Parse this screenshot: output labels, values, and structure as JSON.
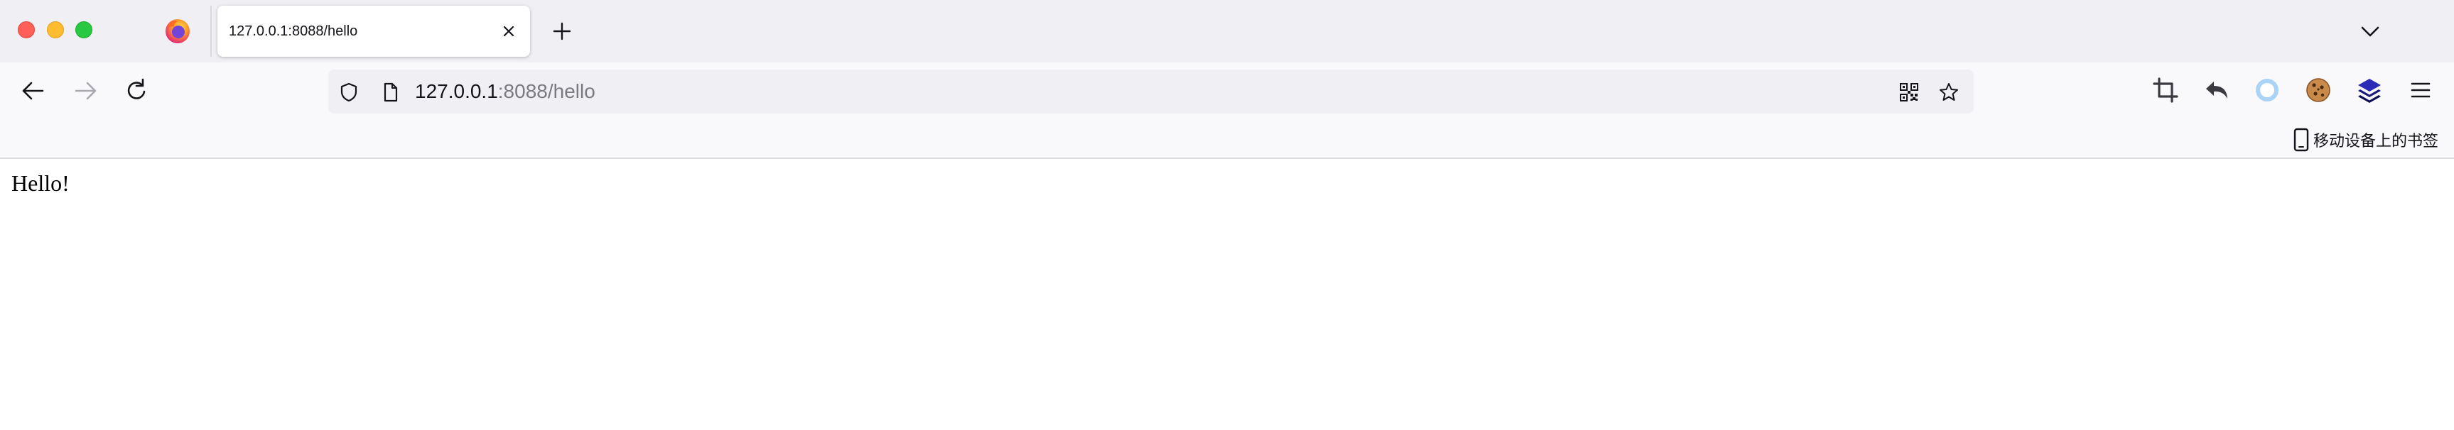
{
  "tabs": [
    {
      "title": "127.0.0.1:8088/hello",
      "active": true,
      "icon": "document-icon"
    }
  ],
  "pinned_tab": {
    "icon": "firefox-icon"
  },
  "navigation": {
    "back": "back-arrow-icon",
    "forward": "forward-arrow-icon",
    "reload": "reload-icon"
  },
  "urlbar": {
    "host": "127.0.0.1",
    "rest": ":8088/hello",
    "icons": [
      "shield-icon",
      "page-icon",
      "qr-code-icon",
      "star-icon"
    ]
  },
  "toolbar": {
    "extensions": [
      "crop-icon",
      "undo-arrow-icon",
      "ring-extension-icon",
      "cookie-icon",
      "layers-icon",
      "hamburger-menu-icon"
    ]
  },
  "bookmarks": {
    "mobile_label": "移动设备上的书签"
  },
  "page": {
    "body_text": "Hello!"
  },
  "colors": {
    "tabstrip_bg": "#f0f0f4",
    "navbar_bg": "#f9f9fb",
    "urlbar_bg": "#f0f0f4",
    "close_red": "#fe5f57",
    "minimize_yellow": "#febc2e",
    "maximize_green": "#28c840"
  }
}
